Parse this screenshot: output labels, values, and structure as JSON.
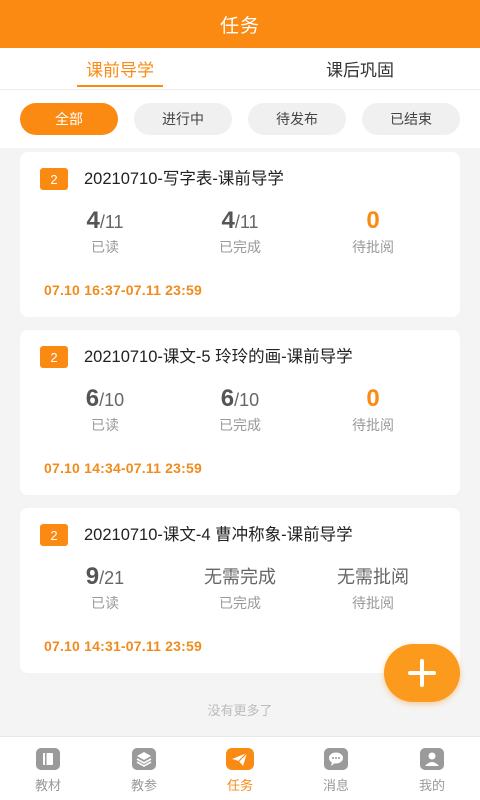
{
  "header": {
    "title": "任务"
  },
  "tabs": [
    {
      "label": "课前导学",
      "active": true
    },
    {
      "label": "课后巩固",
      "active": false
    }
  ],
  "filters": [
    {
      "label": "全部",
      "active": true
    },
    {
      "label": "进行中",
      "active": false
    },
    {
      "label": "待发布",
      "active": false
    },
    {
      "label": "已结束",
      "active": false
    }
  ],
  "tasks": [
    {
      "badge": "2",
      "title": "20210710-写字表-课前导学",
      "read": {
        "num": "4",
        "den": "/11",
        "label": "已读"
      },
      "done": {
        "num": "4",
        "den": "/11",
        "label": "已完成"
      },
      "review": {
        "value": "0",
        "label": "待批阅"
      },
      "time": "07.10 16:37-07.11 23:59"
    },
    {
      "badge": "2",
      "title": "20210710-课文-5 玲玲的画-课前导学",
      "read": {
        "num": "6",
        "den": "/10",
        "label": "已读"
      },
      "done": {
        "num": "6",
        "den": "/10",
        "label": "已完成"
      },
      "review": {
        "value": "0",
        "label": "待批阅"
      },
      "time": "07.10 14:34-07.11 23:59"
    },
    {
      "badge": "2",
      "title": "20210710-课文-4 曹冲称象-课前导学",
      "read": {
        "num": "9",
        "den": "/21",
        "label": "已读"
      },
      "done": {
        "text": "无需完成",
        "label": "已完成"
      },
      "review": {
        "text": "无需批阅",
        "label": "待批阅"
      },
      "time": "07.10 14:31-07.11 23:59"
    }
  ],
  "list_end": "没有更多了",
  "fab": {
    "icon": "plus-icon"
  },
  "bottom_nav": [
    {
      "label": "教材",
      "icon": "book-icon",
      "active": false
    },
    {
      "label": "教参",
      "icon": "layers-icon",
      "active": false
    },
    {
      "label": "任务",
      "icon": "send-icon",
      "active": true
    },
    {
      "label": "消息",
      "icon": "chat-icon",
      "active": false
    },
    {
      "label": "我的",
      "icon": "user-icon",
      "active": false
    }
  ],
  "colors": {
    "accent": "#fb8a13",
    "icon_inactive": "#9a9a9a"
  }
}
